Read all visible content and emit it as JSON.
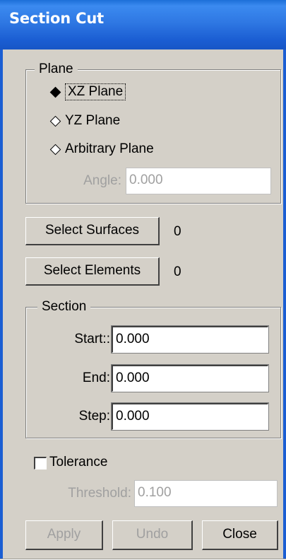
{
  "window": {
    "title": "Section Cut"
  },
  "plane": {
    "legend": "Plane",
    "options": [
      "XZ Plane",
      "YZ Plane",
      "Arbitrary Plane"
    ],
    "selected_index": 0,
    "angle_label": "Angle:",
    "angle_value": "0.000"
  },
  "select": {
    "surfaces_label": "Select Surfaces",
    "surfaces_count": "0",
    "elements_label": "Select Elements",
    "elements_count": "0"
  },
  "section": {
    "legend": "Section",
    "start_label": "Start::",
    "start_value": "0.000",
    "end_label": "End:",
    "end_value": "0.000",
    "step_label": "Step:",
    "step_value": "0.000"
  },
  "tolerance": {
    "label": "Tolerance",
    "checked": false,
    "threshold_label": "Threshold:",
    "threshold_value": "0.100"
  },
  "buttons": {
    "apply": "Apply",
    "undo": "Undo",
    "close": "Close"
  }
}
